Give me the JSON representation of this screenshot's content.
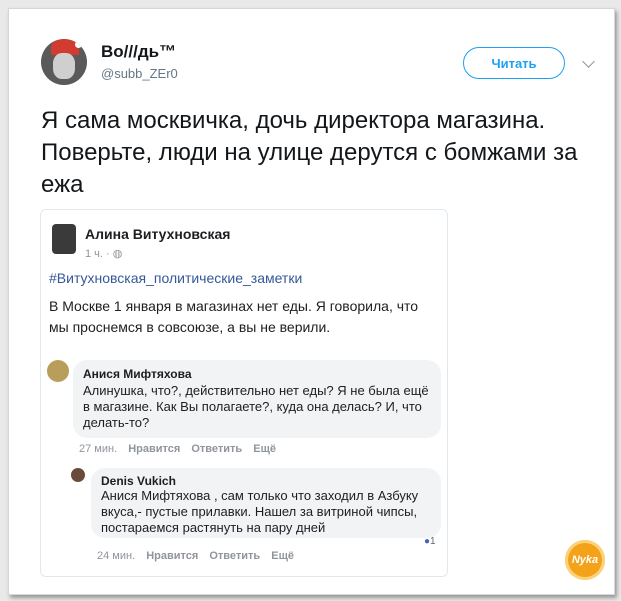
{
  "tweet": {
    "author_name": "Во///дь™",
    "author_handle": "@subb_ZEr0",
    "follow_label": "Читать",
    "text": "Я сама москвичка, дочь директора магазина. Поверьте, люди на улице дерутся с бомжами за ежа"
  },
  "embedded_post": {
    "author": "Алина Витухновская",
    "time": "1 ч. · ◍",
    "hashtag": "#Витухновская_политические_заметки",
    "text": "В Москве 1 января в магазинах нет еды. Я говорила, что мы проснемся в совсоюзе, а вы не верили.",
    "comments": [
      {
        "author": "Анися Мифтяхова",
        "text": "Алинушка, что?, действительно нет еды? Я не была ещё в магазине. Как Вы полагаете?, куда она делась? И, что делать-то?",
        "time": "27 мин.",
        "like_label": "Нравится",
        "reply_label": "Ответить",
        "more_label": "Ещё"
      },
      {
        "author": "Denis Vukich",
        "text": "Анися Мифтяхова , сам только что заходил в Азбуку вкуса,- пустые прилавки. Нашел за витриной чипсы, постараемся растянуть на пару дней",
        "time": "24 мин.",
        "like_label": "Нравится",
        "reply_label": "Ответить",
        "more_label": "Ещё",
        "reactions": "1"
      }
    ]
  },
  "watermark": "Nyka",
  "colors": {
    "accent": "#1da1f2",
    "fb_link": "#365899",
    "logo": "#f5a21b"
  }
}
